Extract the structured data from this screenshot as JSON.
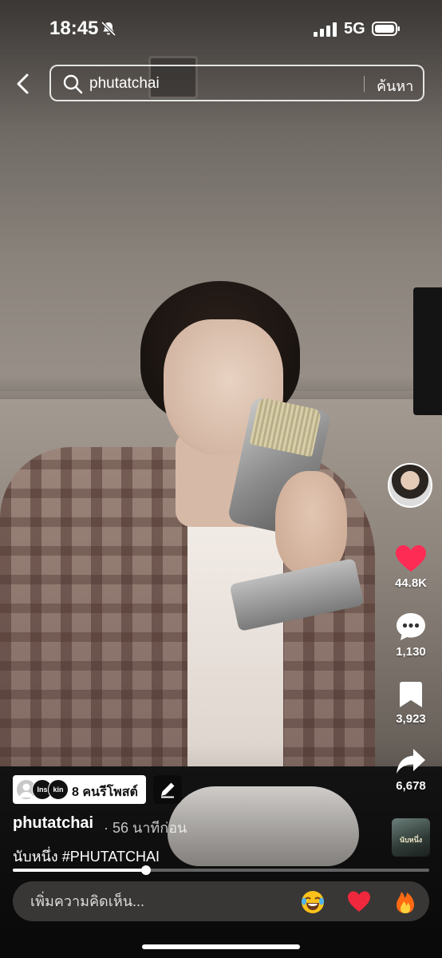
{
  "status_bar": {
    "time": "18:45",
    "network": "5G",
    "icons": [
      "bell-muted-icon",
      "signal-icon",
      "battery-icon"
    ]
  },
  "search": {
    "value": "phutatchai",
    "button_label": "ค้นหา"
  },
  "actions": {
    "likes": "44.8K",
    "comments": "1,130",
    "saves": "3,923",
    "shares": "6,678",
    "like_color": "#fe2c55"
  },
  "repost": {
    "label": "8 คนรีโพสต์",
    "avatar_texts": [
      "",
      "Ins",
      "kin"
    ]
  },
  "video": {
    "author": "phutatchai",
    "time_ago": "· 56 นาทีก่อน",
    "caption": "นับหนึ่ง #PHUTATCHAI",
    "progress": 0.32,
    "music_cover_text": "นับหนึ่ง"
  },
  "comment": {
    "placeholder": "เพิ่มความคิดเห็น...",
    "quick_emojis": [
      "😂",
      "❤️",
      "🔥"
    ]
  }
}
